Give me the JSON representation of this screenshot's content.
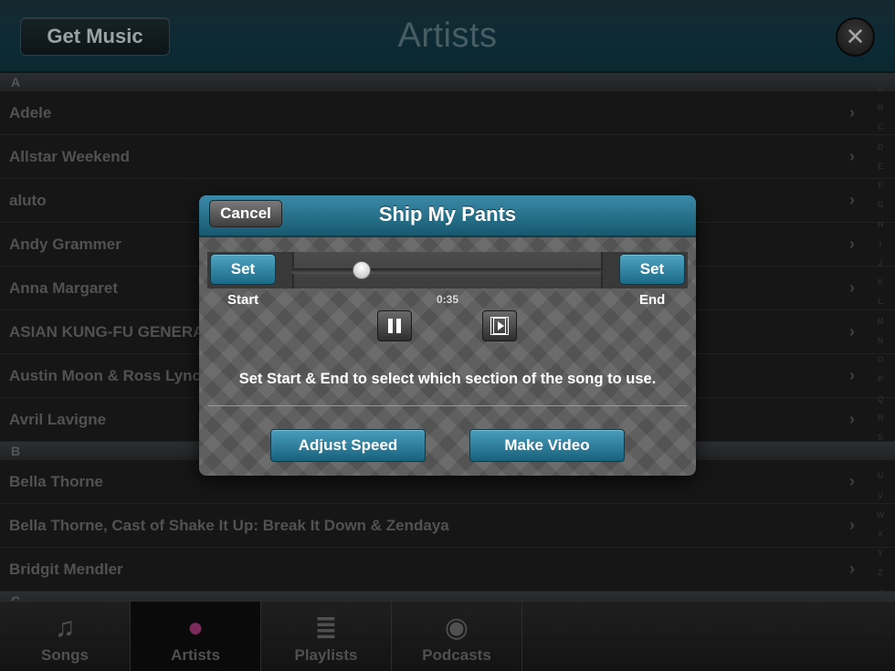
{
  "header": {
    "get_music": "Get Music",
    "title": "Artists",
    "close_glyph": "✕"
  },
  "list": {
    "sections": [
      {
        "letter": "A",
        "artists": [
          "Adele",
          "Allstar Weekend",
          "aluto",
          "Andy Grammer",
          "Anna Margaret",
          "ASIAN KUNG-FU GENERATION",
          "Austin Moon & Ross Lynch",
          "Avril Lavigne"
        ]
      },
      {
        "letter": "B",
        "artists": [
          "Bella Thorne",
          "Bella Thorne, Cast of Shake It Up: Break It Down & Zendaya",
          "Bridgit Mendler"
        ]
      },
      {
        "letter": "C",
        "artists": []
      }
    ],
    "chevron": "›"
  },
  "index": [
    "A",
    "B",
    "C",
    "D",
    "E",
    "F",
    "G",
    "H",
    "I",
    "J",
    "K",
    "L",
    "M",
    "N",
    "O",
    "P",
    "Q",
    "R",
    "S",
    "T",
    "U",
    "V",
    "W",
    "X",
    "Y",
    "Z",
    "#"
  ],
  "tabs": [
    {
      "label": "Songs",
      "icon": "music-note-icon",
      "glyph": "♫"
    },
    {
      "label": "Artists",
      "icon": "person-icon",
      "glyph": "●"
    },
    {
      "label": "Playlists",
      "icon": "playlist-icon",
      "glyph": "≣"
    },
    {
      "label": "Podcasts",
      "icon": "podcast-icon",
      "glyph": "◉"
    }
  ],
  "active_tab": "Artists",
  "dialog": {
    "title": "Ship My Pants",
    "cancel": "Cancel",
    "set_start": "Set",
    "set_end": "Set",
    "start_caption": "Start",
    "end_caption": "End",
    "time": "0:35",
    "instructions": "Set Start & End to select which section of the song to use.",
    "adjust_speed": "Adjust Speed",
    "make_video": "Make Video"
  },
  "colors": {
    "accent": "#2a7f9e",
    "active_tab_icon": "#a6397a"
  }
}
